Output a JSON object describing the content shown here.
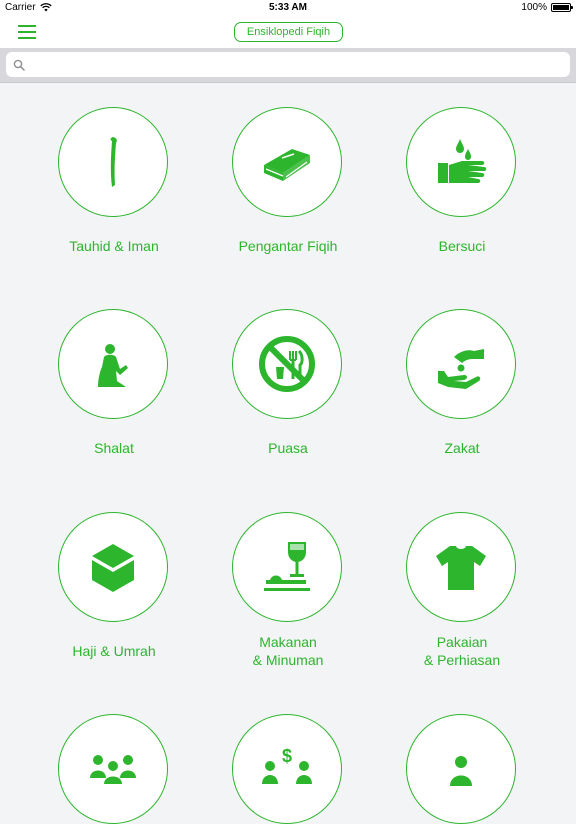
{
  "status_bar": {
    "carrier": "Carrier",
    "time": "5:33 AM",
    "battery": "100%"
  },
  "nav": {
    "title": "Ensiklopedi Fiqih"
  },
  "search": {
    "placeholder": ""
  },
  "accent_color": "#2db52d",
  "categories": [
    {
      "line1": "Tauhid & Iman",
      "line2": "",
      "icon": "alif-icon"
    },
    {
      "line1": "Pengantar Fiqih",
      "line2": "",
      "icon": "book-icon"
    },
    {
      "line1": "Bersuci",
      "line2": "",
      "icon": "hand-water-drops-icon"
    },
    {
      "line1": "Shalat",
      "line2": "",
      "icon": "praying-person-icon"
    },
    {
      "line1": "Puasa",
      "line2": "",
      "icon": "no-food-drink-icon"
    },
    {
      "line1": "Zakat",
      "line2": "",
      "icon": "giving-hand-icon"
    },
    {
      "line1": "Haji & Umrah",
      "line2": "",
      "icon": "kaaba-icon"
    },
    {
      "line1": "Makanan",
      "line2": "& Minuman",
      "icon": "food-drink-icon"
    },
    {
      "line1": "Pakaian",
      "line2": "& Perhiasan",
      "icon": "shirt-icon"
    },
    {
      "line1": "",
      "line2": "",
      "icon": "people-icon"
    },
    {
      "line1": "",
      "line2": "",
      "icon": "trade-icon"
    },
    {
      "line1": "",
      "line2": "",
      "icon": "person-icon"
    }
  ]
}
